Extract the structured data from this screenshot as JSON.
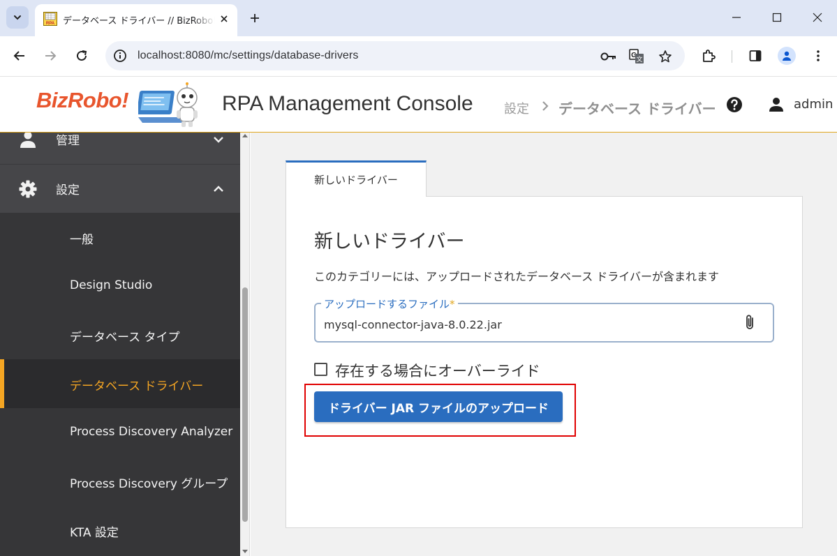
{
  "browser": {
    "tab_title": "データベース ドライバー // BizRobo! Management Console",
    "url": "localhost:8080/mc/settings/database-drivers",
    "favicon_text": "RPA"
  },
  "header": {
    "logo_text": "BizRobo!",
    "app_title": "RPA Management Console",
    "breadcrumb": [
      "設定",
      "データベース ドライバー"
    ],
    "user": "admin"
  },
  "sidebar": {
    "top_items": [
      {
        "label": "管理",
        "icon": "person-icon",
        "expanded": false
      },
      {
        "label": "設定",
        "icon": "gear-icon",
        "expanded": true
      }
    ],
    "sub_items": [
      {
        "label": "一般",
        "active": false
      },
      {
        "label": "Design Studio",
        "active": false
      },
      {
        "label": "データベース タイプ",
        "active": false
      },
      {
        "label": "データベース ドライバー",
        "active": true
      },
      {
        "label": "Process Discovery Analyzer",
        "active": false
      },
      {
        "label": "Process Discovery グループ",
        "active": false
      },
      {
        "label": "KTA 設定",
        "active": false
      }
    ]
  },
  "main": {
    "tab_label": "新しいドライバー",
    "card_title": "新しいドライバー",
    "description": "このカテゴリーには、アップロードされたデータベース ドライバーが含まれます",
    "file_field": {
      "label": "アップロードするファイル",
      "required_mark": "*",
      "value": "mysql-connector-java-8.0.22.jar"
    },
    "override_checkbox": {
      "label": "存在する場合にオーバーライド",
      "checked": false
    },
    "upload_button": "ドライバー JAR ファイルのアップロード"
  },
  "colors": {
    "accent": "#2a6dbf",
    "active_nav": "#f5a623",
    "highlight": "#e00000",
    "logo": "#e8552d"
  }
}
